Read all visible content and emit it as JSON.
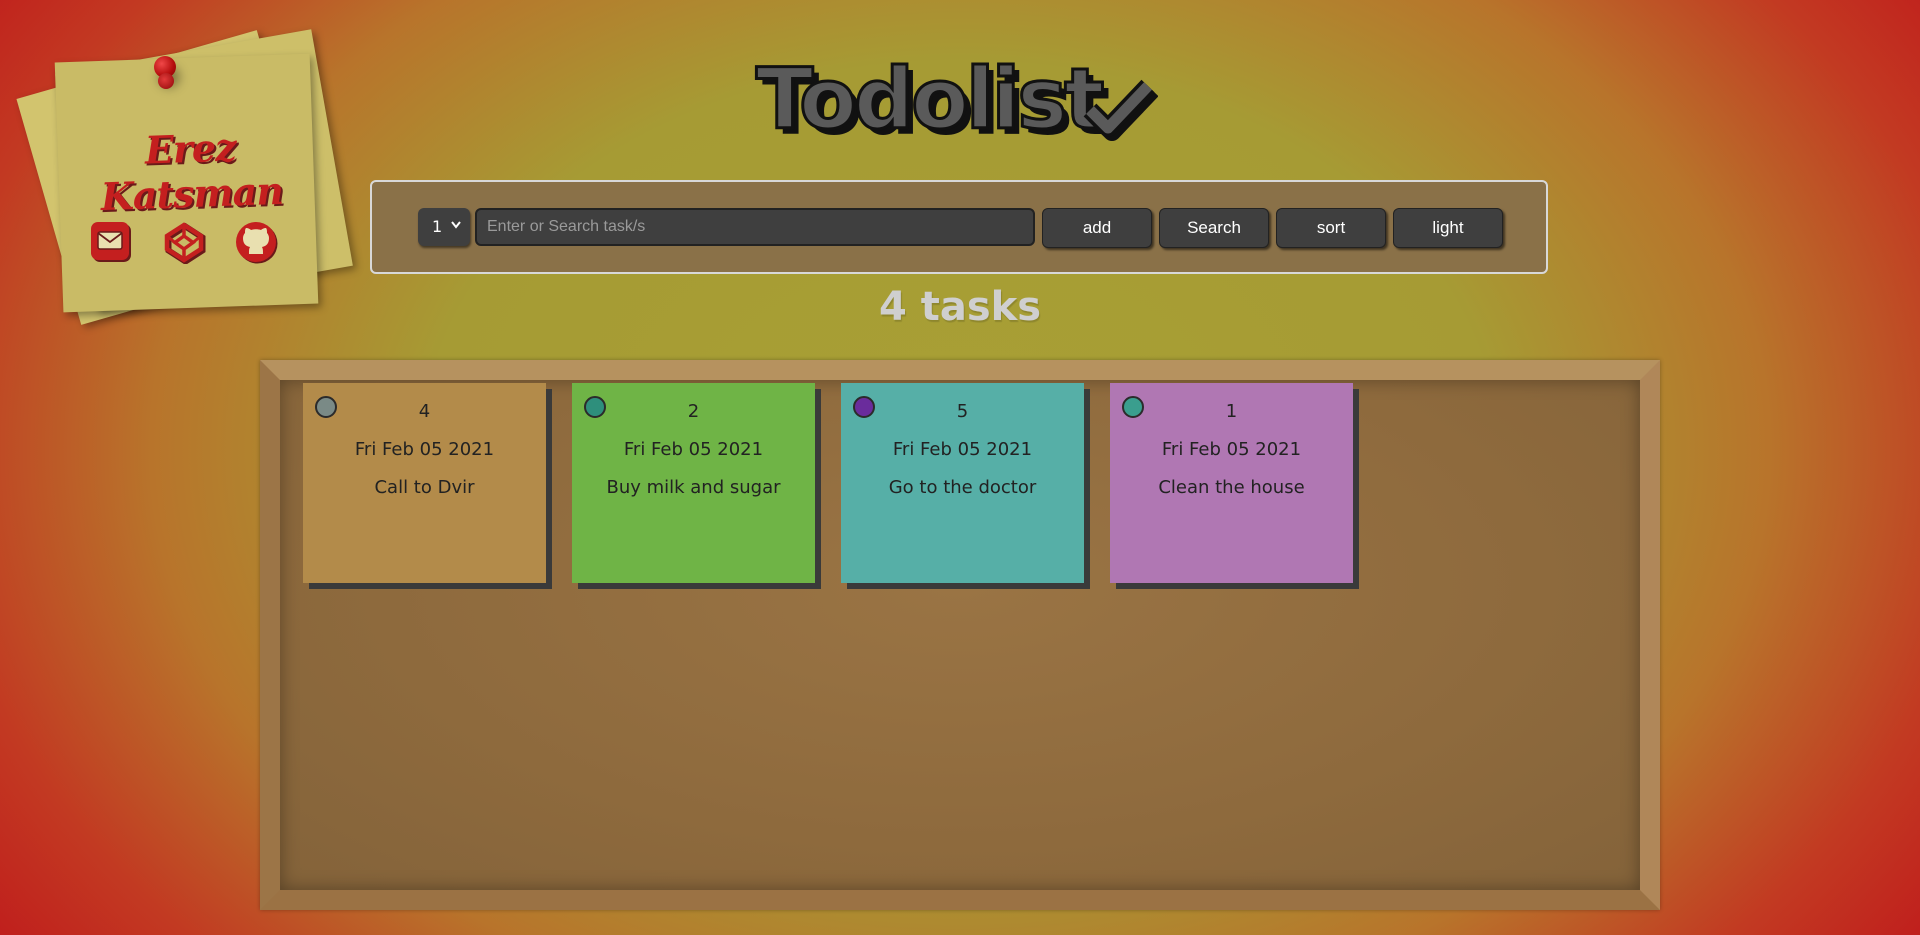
{
  "profile": {
    "name": "Erez Katsman",
    "links": [
      {
        "icon": "mail-icon"
      },
      {
        "icon": "codepen-icon"
      },
      {
        "icon": "github-icon"
      }
    ]
  },
  "header": {
    "title": "Todolist",
    "title_icon": "checkmark-icon"
  },
  "controls": {
    "priority_value": "1",
    "search_placeholder": "Enter or Search task/s",
    "add_label": "add",
    "search_label": "Search",
    "sort_label": "sort",
    "theme_label": "light"
  },
  "task_count": "4 tasks",
  "tasks": [
    {
      "priority": "4",
      "date": "Fri Feb 05 2021",
      "text": "Call to Dvir",
      "color": "#b38b4a",
      "dot_color": "#7a8a86"
    },
    {
      "priority": "2",
      "date": "Fri Feb 05 2021",
      "text": "Buy milk and sugar",
      "color": "#6fb446",
      "dot_color": "#2e8f7c"
    },
    {
      "priority": "5",
      "date": "Fri Feb 05 2021",
      "text": "Go to the doctor",
      "color": "#56afa7",
      "dot_color": "#6a2c9c"
    },
    {
      "priority": "1",
      "date": "Fri Feb 05 2021",
      "text": "Clean the house",
      "color": "#b077b3",
      "dot_color": "#3a9e8e"
    }
  ],
  "colors": {
    "accent_red": "#c41f1f",
    "control_bar": "#8a7148",
    "button": "#3f3f3f"
  }
}
